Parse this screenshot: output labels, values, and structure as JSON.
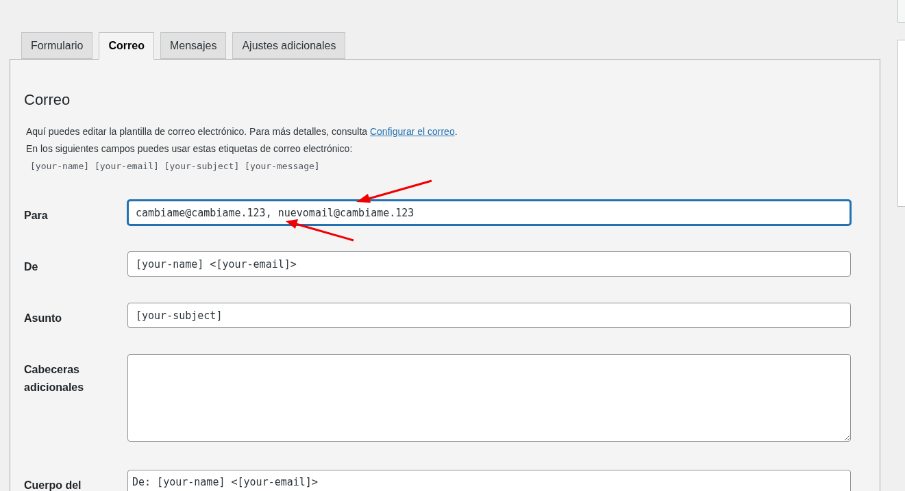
{
  "tabs": [
    {
      "label": "Formulario",
      "selected": false
    },
    {
      "label": "Correo",
      "selected": true
    },
    {
      "label": "Mensajes",
      "selected": false
    },
    {
      "label": "Ajustes adicionales",
      "selected": false
    }
  ],
  "section": {
    "title": "Correo",
    "intro_before": "Aquí puedes editar la plantilla de correo electrónico. Para más detalles, consulta ",
    "intro_link": "Configurar el correo",
    "intro_after": ".",
    "tags_note": "En los siguientes campos puedes usar estas etiquetas de correo electrónico:",
    "tags": "[your-name] [your-email] [your-subject] [your-message]"
  },
  "fields": [
    {
      "label": "Para",
      "kind": "input",
      "value": "cambiame@cambiame.123, nuevomail@cambiame.123",
      "focused": true
    },
    {
      "label": "De",
      "kind": "input",
      "value": "[your-name] <[your-email]>",
      "focused": false
    },
    {
      "label": "Asunto",
      "kind": "input",
      "value": "[your-subject]",
      "focused": false
    },
    {
      "label": "Cabeceras adicionales",
      "kind": "textarea",
      "focused": false
    },
    {
      "label": "Cuerpo del",
      "kind": "textarea_cut",
      "value": "De: [your-name] <[your-email]>",
      "focused": false
    }
  ]
}
